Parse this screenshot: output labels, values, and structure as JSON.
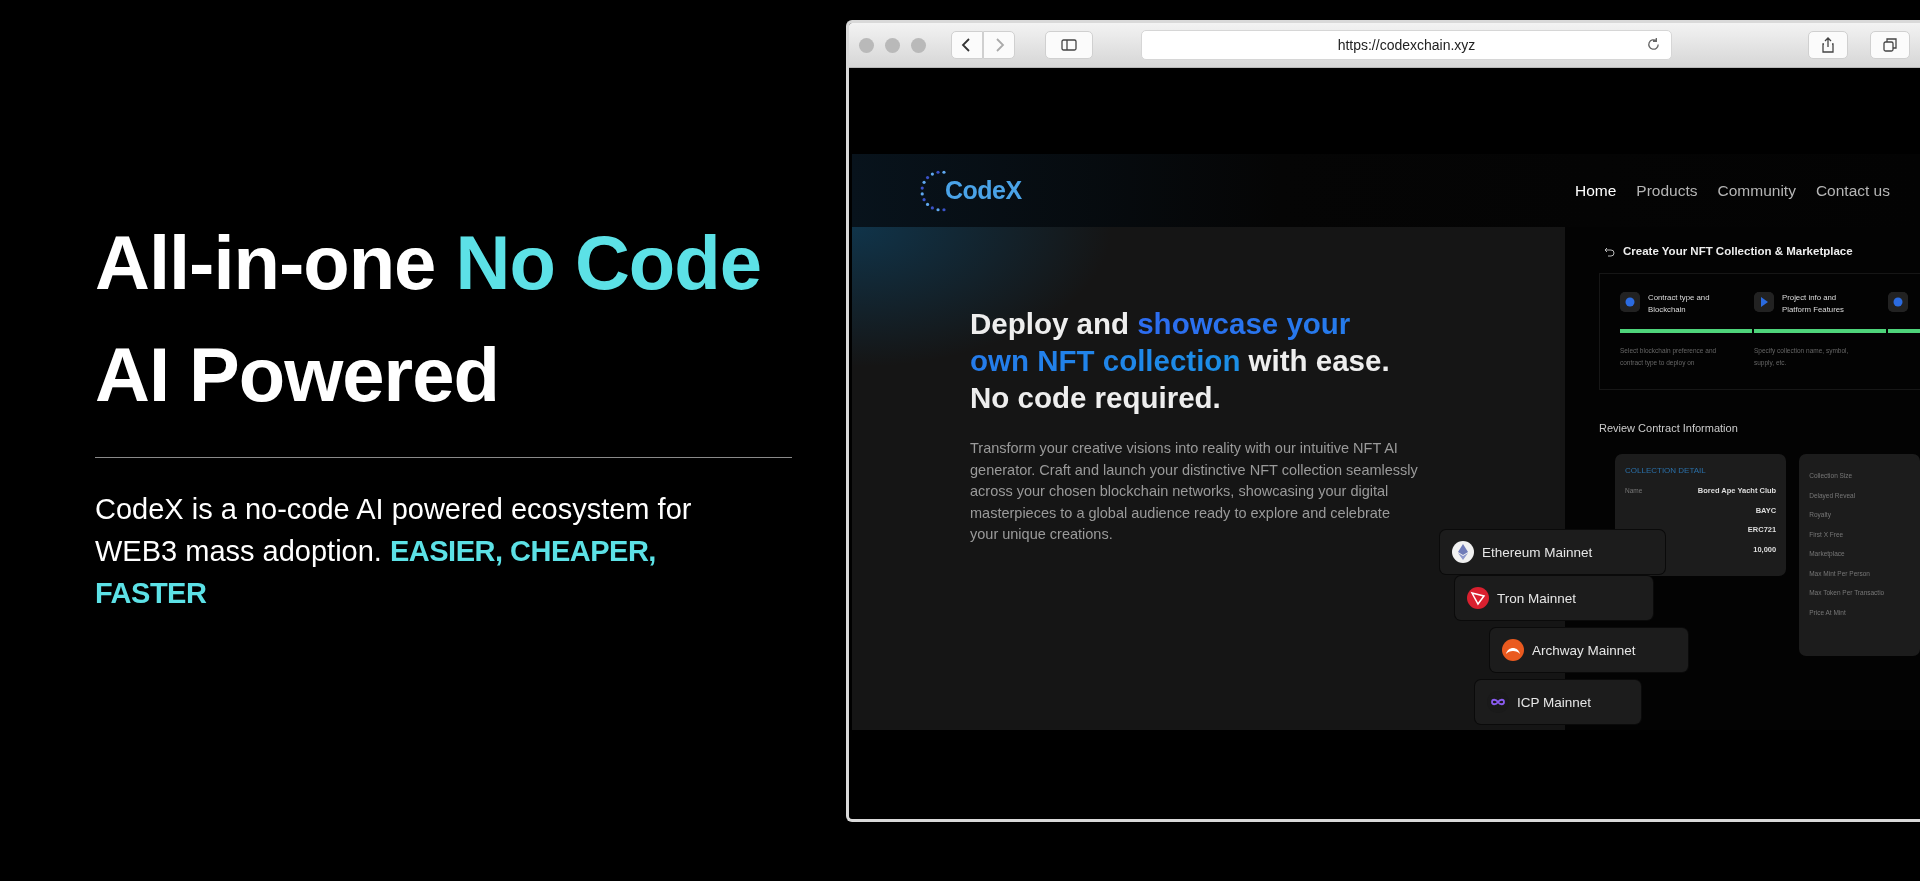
{
  "left": {
    "heading": [
      {
        "text": "All-in-one ",
        "accent": false
      },
      {
        "text": "No Code",
        "accent": true
      },
      {
        "text": " AI Powered",
        "accent": false
      }
    ],
    "intro": [
      {
        "text": "CodeX is a no-code AI powered ecosystem for WEB3 mass adoption. ",
        "accent": false
      },
      {
        "text": "EASIER, CHEAPER, FASTER",
        "accent": true
      }
    ]
  },
  "browser": {
    "url": "https://codexchain.xyz"
  },
  "site": {
    "logo": "CodeX",
    "nav": [
      {
        "label": "Home",
        "selected": true
      },
      {
        "label": "Products",
        "selected": false
      },
      {
        "label": "Community",
        "selected": false
      },
      {
        "label": "Contact us",
        "selected": false
      }
    ],
    "hero": {
      "heading": [
        {
          "text": "Deploy and ",
          "accent": false
        },
        {
          "text": "showcase your own NFT collection",
          "accent": true
        },
        {
          "text": " with ease. No code required.",
          "accent": false
        }
      ],
      "text": "Transform your creative visions into reality with our intuitive NFT AI generator. Craft and launch your distinctive NFT collection seamlessly across your chosen blockchain networks, showcasing your digital masterpieces to a global audience ready to explore and celebrate your unique creations."
    },
    "wizard": {
      "title": "Create Your NFT Collection & Marketplace",
      "steps": [
        {
          "title": "Contract type and Blockchain",
          "description": "Select blockchain preference and contract type to deploy on",
          "done": true
        },
        {
          "title": "Project info and Platform Features",
          "description": "Specify collection name, symbol, supply, etc.",
          "done": true
        },
        {
          "done": true
        }
      ]
    },
    "review": {
      "title": "Review Contract Information",
      "cards": [
        {
          "heading": "COLLECTION DETAIL",
          "rows": [
            {
              "label": "Name",
              "value": "Bored Ape Yacht Club"
            },
            {
              "value": "BAYC"
            },
            {
              "value": "ERC721"
            },
            {
              "value": "10,000"
            }
          ]
        },
        {
          "rows": [
            {
              "label": "Collection Size"
            },
            {
              "label": "Delayed Reveal"
            },
            {
              "label": "Royalty"
            },
            {
              "label": "First X Free"
            },
            {
              "label": "Marketplace"
            },
            {
              "label": "Max Mint Per Person"
            },
            {
              "label": "Max Token Per Transactio"
            },
            {
              "label": "Price At Mint"
            }
          ]
        }
      ]
    },
    "networks": [
      {
        "name": "Ethereum Mainnet",
        "kind": "ethereum"
      },
      {
        "name": "Tron Mainnet",
        "kind": "tron"
      },
      {
        "name": "Archway Mainnet",
        "kind": "archway"
      },
      {
        "name": "ICP Mainnet",
        "kind": "icp"
      }
    ]
  }
}
